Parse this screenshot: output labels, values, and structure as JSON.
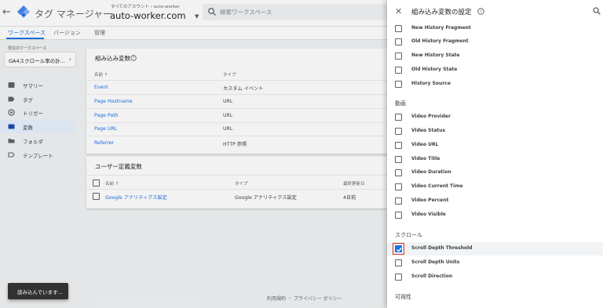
{
  "topbar": {
    "back_icon": "←",
    "app_name": "タグ マネージャー",
    "account_path": "すべてのアカウント › auto-worker",
    "container_name": "auto-worker.com",
    "search_placeholder": "検索ワークスペース"
  },
  "tabs": [
    "ワークスペース",
    "バージョン",
    "管理"
  ],
  "sidebar": {
    "workspace_label": "現在のワークスペース",
    "workspace_name": "GA4スクロール率の計...",
    "items": [
      {
        "label": "サマリー",
        "icon": "summary-icon"
      },
      {
        "label": "タグ",
        "icon": "tag-icon"
      },
      {
        "label": "トリガー",
        "icon": "trigger-icon"
      },
      {
        "label": "変数",
        "icon": "variables-icon",
        "active": true
      },
      {
        "label": "フォルダ",
        "icon": "folder-icon"
      },
      {
        "label": "テンプレート",
        "icon": "template-icon"
      }
    ]
  },
  "builtin": {
    "title": "組み込み変数",
    "col_name": "名前 ↑",
    "col_type": "タイプ",
    "rows": [
      {
        "name": "Event",
        "type": "カスタム イベント"
      },
      {
        "name": "Page Hostname",
        "type": "URL"
      },
      {
        "name": "Page Path",
        "type": "URL"
      },
      {
        "name": "Page URL",
        "type": "URL"
      },
      {
        "name": "Referrer",
        "type": "HTTP 参照"
      }
    ]
  },
  "user_defined": {
    "title": "ユーザー定義変数",
    "col_name": "名前 ↑",
    "col_type": "タイプ",
    "col_edited": "最終更新日",
    "rows": [
      {
        "name": "Google アナリティクス設定",
        "type": "Google アナリティクス設定",
        "edited": "4日前"
      }
    ]
  },
  "footer": "利用規約 ・ プライバシー ポリシー",
  "toast": "読み込んでいます...",
  "panel": {
    "title": "組み込み変数の設定",
    "top_items": [
      {
        "name": "New History Fragment",
        "checked": false
      },
      {
        "name": "Old History Fragment",
        "checked": false
      },
      {
        "name": "New History State",
        "checked": false
      },
      {
        "name": "Old History State",
        "checked": false
      },
      {
        "name": "History Source",
        "checked": false
      }
    ],
    "section_video": "動画",
    "video_items": [
      {
        "name": "Video Provider",
        "checked": false
      },
      {
        "name": "Video Status",
        "checked": false
      },
      {
        "name": "Video URL",
        "checked": false
      },
      {
        "name": "Video Title",
        "checked": false
      },
      {
        "name": "Video Duration",
        "checked": false
      },
      {
        "name": "Video Current Time",
        "checked": false
      },
      {
        "name": "Video Percent",
        "checked": false
      },
      {
        "name": "Video Visible",
        "checked": false
      }
    ],
    "section_scroll": "スクロール",
    "scroll_items": [
      {
        "name": "Scroll Depth Threshold",
        "checked": true
      },
      {
        "name": "Scroll Depth Units",
        "checked": false
      },
      {
        "name": "Scroll Direction",
        "checked": false
      }
    ],
    "section_visibility": "可視性"
  },
  "colors": {
    "accent": "#1a73e8",
    "highlight": "#d93025",
    "toast_bg": "#323232"
  }
}
